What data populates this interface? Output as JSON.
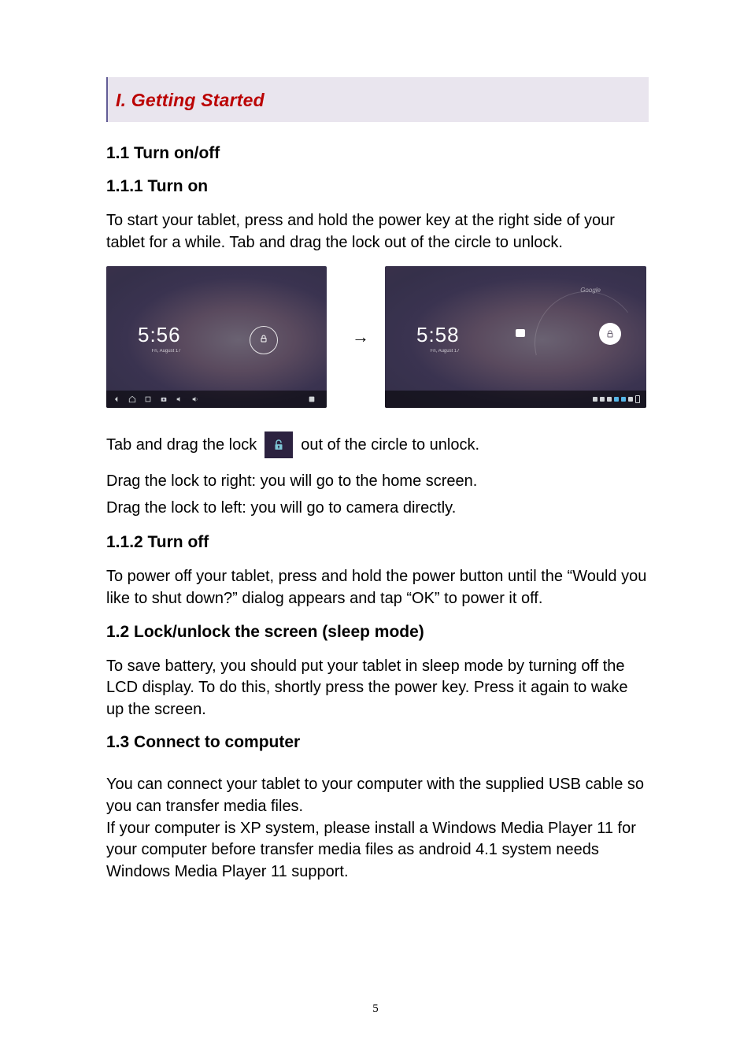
{
  "banner": {
    "title": "I. Getting Started"
  },
  "s11": {
    "heading": "1.1 Turn on/off",
    "h111": "1.1.1 Turn on",
    "p111": "To start your tablet, press and hold the power key at the right side of your tablet for a while. Tab and drag the lock out of the circle to unlock.",
    "unlock_before": "Tab and drag the lock",
    "unlock_after": "out of the circle to unlock.",
    "drag_right": "Drag the lock to right: you will go to the home screen.",
    "drag_left": "Drag the lock to left: you will go to camera directly.",
    "h112": "1.1.2 Turn off",
    "p112": "To power off your tablet, press and hold the power button until the “Would you like to shut down?” dialog appears and tap “OK” to power it off."
  },
  "s12": {
    "heading": "1.2 Lock/unlock the screen (sleep mode)",
    "p": "To save battery, you should put your tablet in sleep mode by turning off the LCD display. To do this, shortly press the power key. Press it again to wake up the screen."
  },
  "s13": {
    "heading": "1.3 Connect to computer",
    "p": "You can connect your tablet to your computer with the supplied USB cable so you can transfer media files.\nIf your computer is XP system, please install a Windows Media Player 11 for your computer before transfer media files as android 4.1 system needs Windows Media Player 11 support."
  },
  "screens": {
    "left": {
      "time": "5:56",
      "date": "Fri, August 17"
    },
    "right": {
      "time": "5:58",
      "date": "Fri, August 17",
      "google": "Google"
    },
    "arrow": "→"
  },
  "page_number": "5"
}
